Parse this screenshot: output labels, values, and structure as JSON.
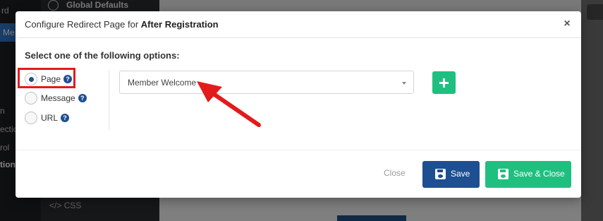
{
  "background": {
    "left_fragments": [
      "rd",
      "Me",
      "n",
      "ectio",
      "rol",
      "tion"
    ],
    "sidebar_item": "Global Defaults",
    "sidebar_css_label": "CSS",
    "accent": "#2d76c8"
  },
  "modal": {
    "title_prefix": "Configure Redirect Page for",
    "title_bold": "After Registration",
    "close_label": "×",
    "section_label": "Select one of the following options:",
    "options": [
      {
        "label": "Page",
        "help": "?",
        "checked": true
      },
      {
        "label": "Message",
        "help": "?",
        "checked": false
      },
      {
        "label": "URL",
        "help": "?",
        "checked": false
      }
    ],
    "select": {
      "value": "Member Welcome"
    },
    "add_button_icon": "plus-icon",
    "footer": {
      "close_label": "Close",
      "save_label": "Save",
      "save_close_label": "Save & Close"
    }
  },
  "colors": {
    "primary": "#1d4f91",
    "success": "#1fbf80",
    "highlight": "#e31b1b"
  }
}
